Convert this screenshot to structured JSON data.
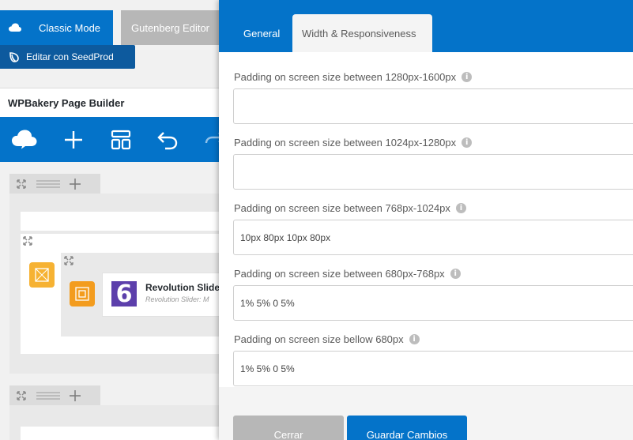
{
  "editor": {
    "classic_mode_label": "Classic Mode",
    "gutenberg_label": "Gutenberg Editor",
    "seedprod_label": "Editar con SeedProd",
    "wpbakery_title": "WPBakery Page Builder",
    "element": {
      "title": "Revolution Slider",
      "subtitle": "Revolution Slider: M",
      "logo_char": "6"
    }
  },
  "modal": {
    "tabs": [
      {
        "label": "General"
      },
      {
        "label": "Width & Responsiveness"
      }
    ],
    "fields": [
      {
        "label": "Padding on screen size between 1280px-1600px",
        "value": ""
      },
      {
        "label": "Padding on screen size between 1024px-1280px",
        "value": ""
      },
      {
        "label": "Padding on screen size between 768px-1024px",
        "value": "10px 80px 10px 80px"
      },
      {
        "label": "Padding on screen size between 680px-768px",
        "value": "1% 5% 0 5%"
      },
      {
        "label": "Padding on screen size bellow 680px",
        "value": "1% 5% 0 5%"
      }
    ],
    "close_label": "Cerrar",
    "save_label": "Guardar Cambios"
  },
  "colors": {
    "primary": "#0473c9",
    "seedprod": "#0d5a9e",
    "secondary_button": "#b7b7b7",
    "element_orange": "#f6b233",
    "revslider_purple": "#5c3fab"
  },
  "icons": [
    "cloud-icon",
    "seedprod-leaf-icon",
    "plus-icon",
    "layout-icon",
    "undo-icon",
    "expand-icon",
    "drag-handle-icon",
    "info-icon"
  ]
}
